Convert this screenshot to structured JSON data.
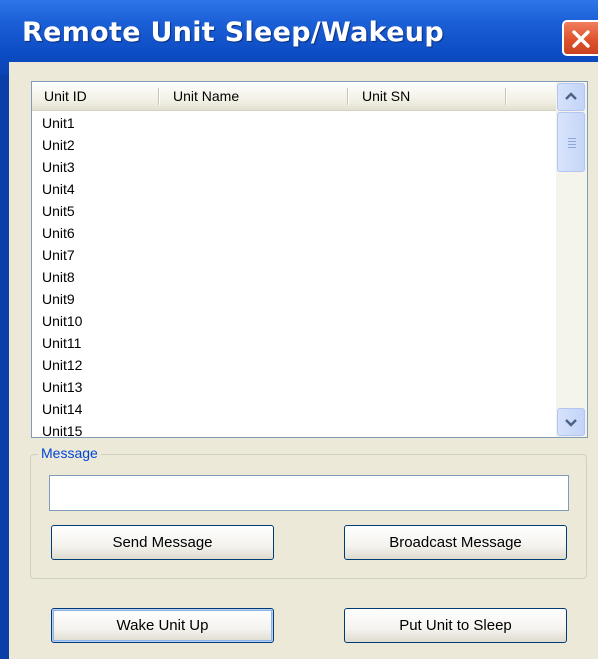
{
  "window": {
    "title": "Remote Unit Sleep/Wakeup"
  },
  "listview": {
    "columns": [
      "Unit ID",
      "Unit Name",
      "Unit SN"
    ],
    "rows": [
      "Unit1",
      "Unit2",
      "Unit3",
      "Unit4",
      "Unit5",
      "Unit6",
      "Unit7",
      "Unit8",
      "Unit9",
      "Unit10",
      "Unit11",
      "Unit12",
      "Unit13",
      "Unit14",
      "Unit15"
    ]
  },
  "message": {
    "group_label": "Message",
    "input_value": "",
    "send_label": "Send Message",
    "broadcast_label": "Broadcast Message"
  },
  "actions": {
    "wake_label": "Wake Unit Up",
    "sleep_label": "Put Unit to Sleep"
  },
  "colors": {
    "title_bar": "#0d4cc4",
    "close_button": "#e0522e",
    "group_label": "#0046d5",
    "dialog_bg": "#ece9d8"
  },
  "icons": {
    "close": "close-icon",
    "scroll_up": "chevron-up-icon",
    "scroll_down": "chevron-down-icon"
  }
}
